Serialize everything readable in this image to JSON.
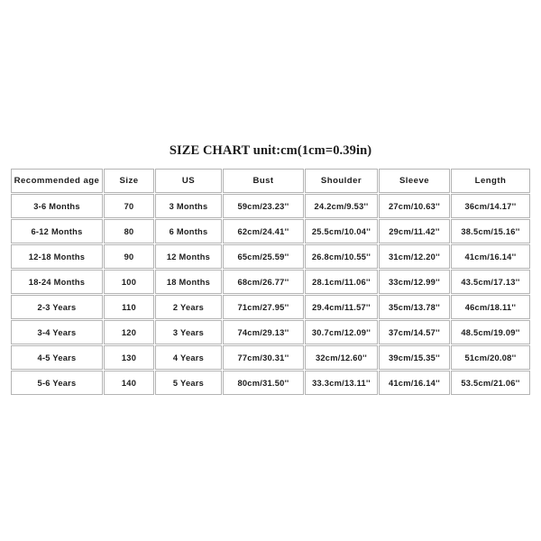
{
  "title": "SIZE CHART unit:cm(1cm=0.39in)",
  "table": {
    "headers": [
      "Recommended age",
      "Size",
      "US",
      "Bust",
      "Shoulder",
      "Sleeve",
      "Length"
    ],
    "rows": [
      [
        "3-6 Months",
        "70",
        "3 Months",
        "59cm/23.23''",
        "24.2cm/9.53''",
        "27cm/10.63''",
        "36cm/14.17''"
      ],
      [
        "6-12 Months",
        "80",
        "6 Months",
        "62cm/24.41''",
        "25.5cm/10.04''",
        "29cm/11.42''",
        "38.5cm/15.16''"
      ],
      [
        "12-18 Months",
        "90",
        "12 Months",
        "65cm/25.59''",
        "26.8cm/10.55''",
        "31cm/12.20''",
        "41cm/16.14''"
      ],
      [
        "18-24 Months",
        "100",
        "18 Months",
        "68cm/26.77''",
        "28.1cm/11.06''",
        "33cm/12.99''",
        "43.5cm/17.13''"
      ],
      [
        "2-3 Years",
        "110",
        "2 Years",
        "71cm/27.95''",
        "29.4cm/11.57''",
        "35cm/13.78''",
        "46cm/18.11''"
      ],
      [
        "3-4 Years",
        "120",
        "3 Years",
        "74cm/29.13''",
        "30.7cm/12.09''",
        "37cm/14.57''",
        "48.5cm/19.09''"
      ],
      [
        "4-5 Years",
        "130",
        "4 Years",
        "77cm/30.31''",
        "32cm/12.60''",
        "39cm/15.35''",
        "51cm/20.08''"
      ],
      [
        "5-6 Years",
        "140",
        "5 Years",
        "80cm/31.50''",
        "33.3cm/13.11''",
        "41cm/16.14''",
        "53.5cm/21.06''"
      ]
    ]
  },
  "colors": {
    "background": "#ffffff",
    "border": "#b4b4b4",
    "text": "#1c1c1c",
    "title_text": "#1a1a1a"
  }
}
